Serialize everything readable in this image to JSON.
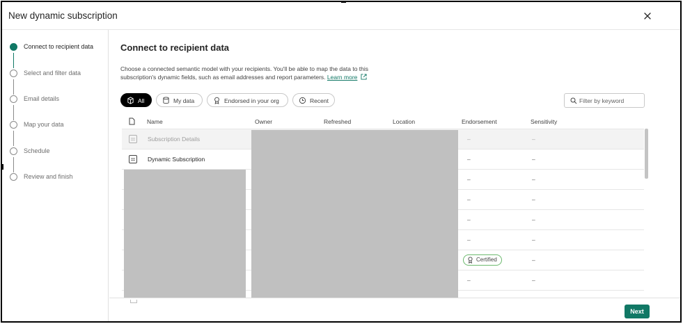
{
  "dialog": {
    "title": "New dynamic subscription",
    "close_icon": "close-icon"
  },
  "steps": [
    {
      "label": "Connect to recipient data",
      "active": true
    },
    {
      "label": "Select and filter data",
      "active": false
    },
    {
      "label": "Email details",
      "active": false
    },
    {
      "label": "Map your data",
      "active": false
    },
    {
      "label": "Schedule",
      "active": false
    },
    {
      "label": "Review and finish",
      "active": false
    }
  ],
  "main": {
    "heading": "Connect to recipient data",
    "description": "Choose a connected semantic model with your recipients. You'll be able to map the data to this subscription's dynamic fields, such as email addresses and report parameters.",
    "learn_more": "Learn more"
  },
  "filters": {
    "chips": [
      {
        "label": "All",
        "icon": "cube-icon",
        "selected": true
      },
      {
        "label": "My data",
        "icon": "database-icon",
        "selected": false
      },
      {
        "label": "Endorsed in your org",
        "icon": "ribbon-icon",
        "selected": false
      },
      {
        "label": "Recent",
        "icon": "clock-icon",
        "selected": false
      }
    ],
    "search_placeholder": "Filter by keyword"
  },
  "table": {
    "columns": {
      "name": "Name",
      "owner": "Owner",
      "refreshed": "Refreshed",
      "location": "Location",
      "endorsement": "Endorsement",
      "sensitivity": "Sensitivity"
    },
    "rows": [
      {
        "name": "Subscription Details",
        "endorsement": "–",
        "sensitivity": "–",
        "disabled": true
      },
      {
        "name": "Dynamic Subscription",
        "endorsement": "–",
        "sensitivity": "–",
        "disabled": false
      },
      {
        "name": "",
        "endorsement": "–",
        "sensitivity": "–",
        "disabled": false
      },
      {
        "name": "",
        "endorsement": "–",
        "sensitivity": "–",
        "disabled": false
      },
      {
        "name": "",
        "endorsement": "–",
        "sensitivity": "–",
        "disabled": false
      },
      {
        "name": "",
        "endorsement": "–",
        "sensitivity": "–",
        "disabled": false
      },
      {
        "name": "",
        "endorsement": "Certified",
        "sensitivity": "–",
        "disabled": false,
        "certified": true
      },
      {
        "name": "",
        "endorsement": "–",
        "sensitivity": "–",
        "disabled": false
      }
    ]
  },
  "footer": {
    "next_label": "Next"
  },
  "colors": {
    "accent": "#117865",
    "redaction": "#c0c0c0",
    "certified_border": "#6bb96d"
  }
}
